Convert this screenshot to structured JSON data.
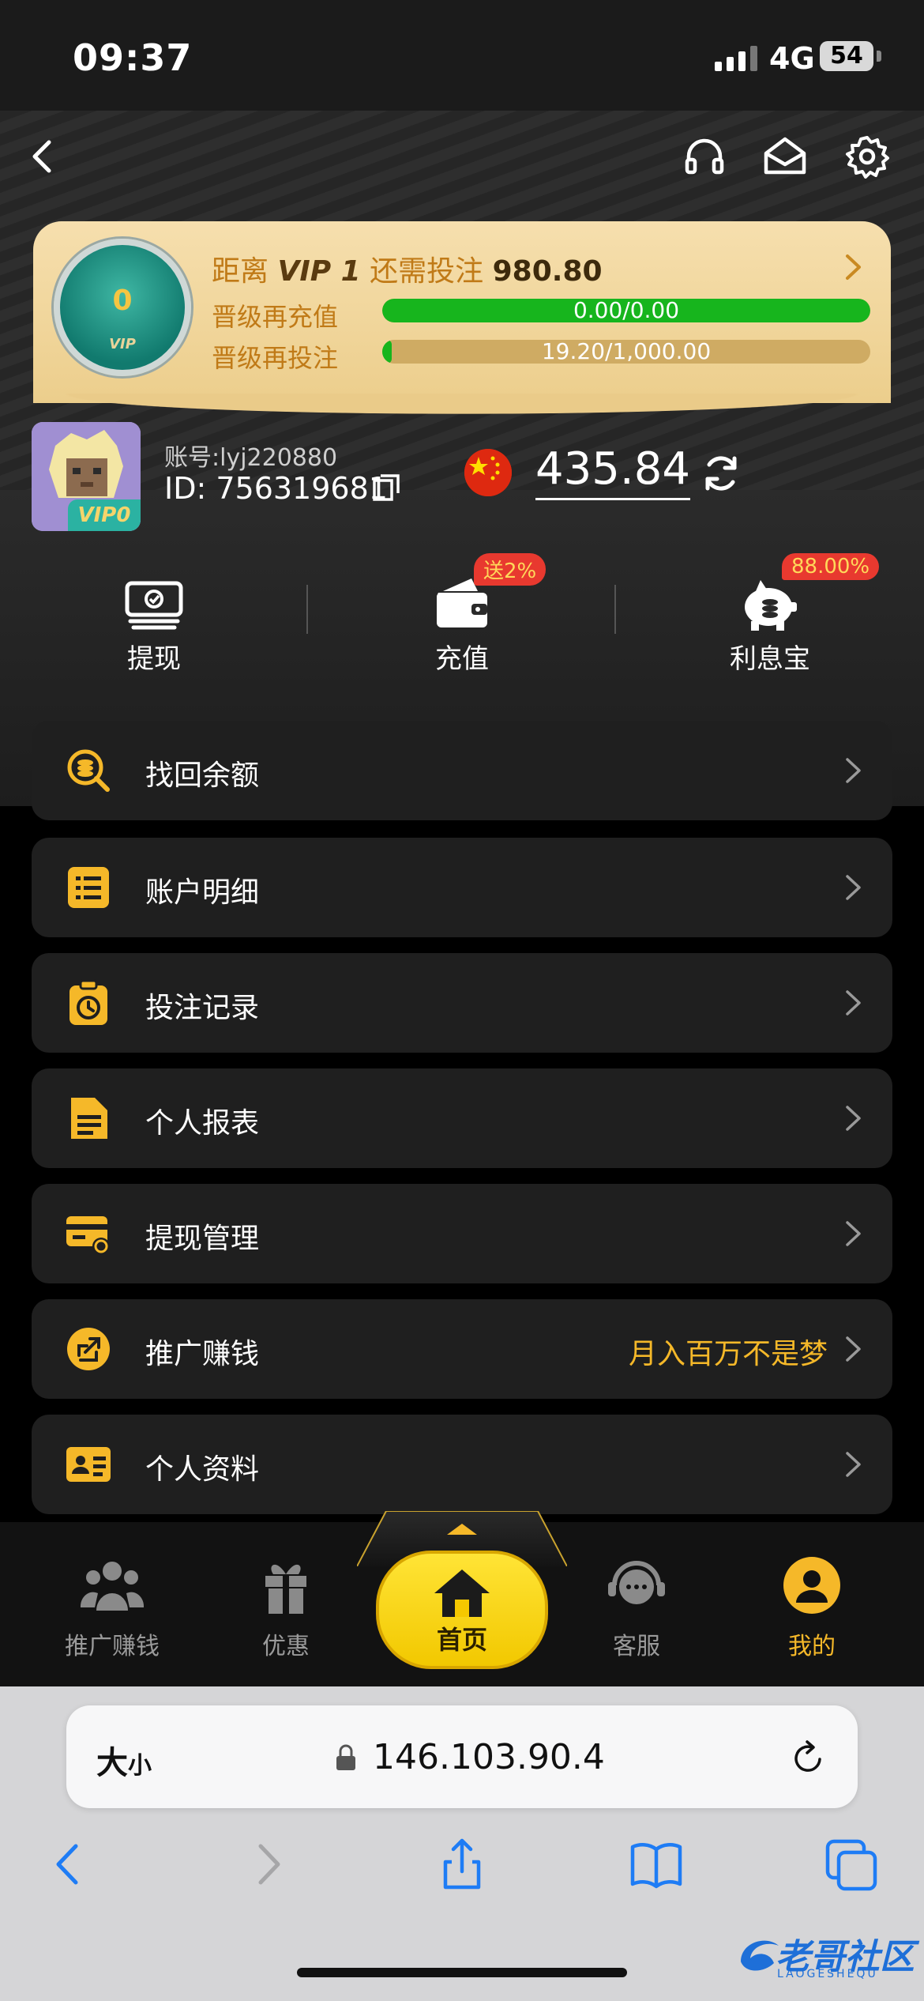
{
  "status_bar": {
    "time": "09:37",
    "network": "4G",
    "battery": "54"
  },
  "vip": {
    "level": "0",
    "badge_label": "VIP",
    "title_prefix": "距离",
    "target_level": "VIP 1",
    "title_middle": "还需投注",
    "remaining": "980.80",
    "recharge_label": "晋级再充值",
    "recharge_progress_text": "0.00/0.00",
    "recharge_progress": 1.0,
    "bet_label": "晋级再投注",
    "bet_progress_text": "19.20/1,000.00",
    "bet_progress": 0.0192
  },
  "account": {
    "username": "账号:lyj220880",
    "id": "ID: 756319681",
    "avatar_vip": "VIP0",
    "balance": "435.84"
  },
  "actions": [
    {
      "label": "提现",
      "tag": ""
    },
    {
      "label": "充值",
      "tag": "送2%"
    },
    {
      "label": "利息宝",
      "tag": "88.00%"
    }
  ],
  "menu": [
    {
      "label": "找回余额",
      "hint": ""
    },
    {
      "label": "账户明细",
      "hint": ""
    },
    {
      "label": "投注记录",
      "hint": ""
    },
    {
      "label": "个人报表",
      "hint": ""
    },
    {
      "label": "提现管理",
      "hint": ""
    },
    {
      "label": "推广赚钱",
      "hint": "月入百万不是梦"
    },
    {
      "label": "个人资料",
      "hint": ""
    }
  ],
  "tabbar": {
    "tabs": [
      {
        "label": "推广赚钱"
      },
      {
        "label": "优惠"
      },
      {
        "label": "首页"
      },
      {
        "label": "客服"
      },
      {
        "label": "我的"
      }
    ]
  },
  "browser": {
    "text_size": "大",
    "text_size_small": "小",
    "url": "146.103.90.4"
  },
  "watermark": {
    "text": "老哥社区",
    "sub": "LAOGESHEQU"
  },
  "colors": {
    "accent": "#f5b829",
    "progress_green": "#17b51d",
    "badge_red": "#e8392f"
  }
}
